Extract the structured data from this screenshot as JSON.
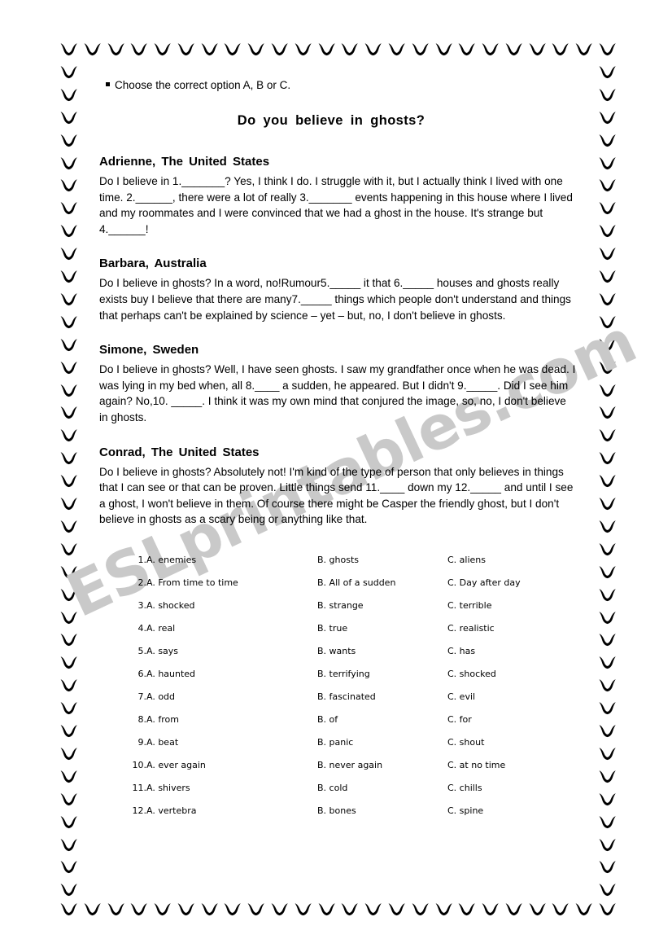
{
  "instruction": "Choose the correct option A, B or C.",
  "title": "Do  you  believe  in  ghosts?",
  "watermark": "ESLprintables.com",
  "people": [
    {
      "name": "Adrienne,  The  United  States",
      "text": "Do I believe in 1._______? Yes, I think I do. I struggle with it, but I actually think I lived with one time. 2.______, there were a lot of really 3._______ events happening in this house where I lived and my roommates and I were convinced that we had a ghost in the house. It's strange but 4.______!"
    },
    {
      "name": "Barbara,  Australia",
      "text": "Do I believe in ghosts? In a word, no!Rumour5._____ it that 6._____ houses and ghosts really exists buy I believe that there are many7._____ things which people don't understand and things that perhaps can't be explained by science – yet – but, no, I don't believe in ghosts."
    },
    {
      "name": "Simone,  Sweden",
      "text": "Do I believe in ghosts? Well, I have seen ghosts. I saw my grandfather once when he was dead. I was lying in my bed when, all 8.____ a sudden, he appeared. But I didn't 9._____. Did I see him again? No,10. _____. I think it was my own mind that conjured the image, so, no, I don't believe in ghosts."
    },
    {
      "name": "Conrad,  The  United  States",
      "text": "Do I believe in ghosts? Absolutely not! I'm kind of the type of person that only believes in things that I can see or that can be proven. Little things send 11.____ down my 12._____ and until I see a ghost, I won't believe in them. Of course there might be Casper the friendly ghost, but I don't believe in ghosts as a scary being or anything like that."
    }
  ],
  "options": [
    {
      "num": "1.",
      "a": "A. enemies",
      "b": "B. ghosts",
      "c": "C. aliens"
    },
    {
      "num": "2.",
      "a": "A. From time to time",
      "b": "B. All of a sudden",
      "c": "C. Day after day"
    },
    {
      "num": "3.",
      "a": "A. shocked",
      "b": "B. strange",
      "c": "C. terrible"
    },
    {
      "num": "4.",
      "a": "A. real",
      "b": "B. true",
      "c": "C. realistic"
    },
    {
      "num": "5.",
      "a": "A. says",
      "b": "B. wants",
      "c": "C. has"
    },
    {
      "num": "6.",
      "a": "A. haunted",
      "b": "B. terrifying",
      "c": "C. shocked"
    },
    {
      "num": "7.",
      "a": "A. odd",
      "b": "B. fascinated",
      "c": "C. evil"
    },
    {
      "num": "8.",
      "a": "A. from",
      "b": "B. of",
      "c": "C. for"
    },
    {
      "num": "9.",
      "a": "A. beat",
      "b": "B. panic",
      "c": "C. shout"
    },
    {
      "num": "10.",
      "a": "A. ever again",
      "b": "B. never again",
      "c": "C. at no time"
    },
    {
      "num": "11.",
      "a": "A. shivers",
      "b": "B. cold",
      "c": "C. chills"
    },
    {
      "num": "12.",
      "a": "A. vertebra",
      "b": "B. bones",
      "c": "C. spine"
    }
  ],
  "border": {
    "icon": "bat-icon",
    "color": "#000000",
    "top_count": 24,
    "bottom_count": 24,
    "side_count": 38
  }
}
